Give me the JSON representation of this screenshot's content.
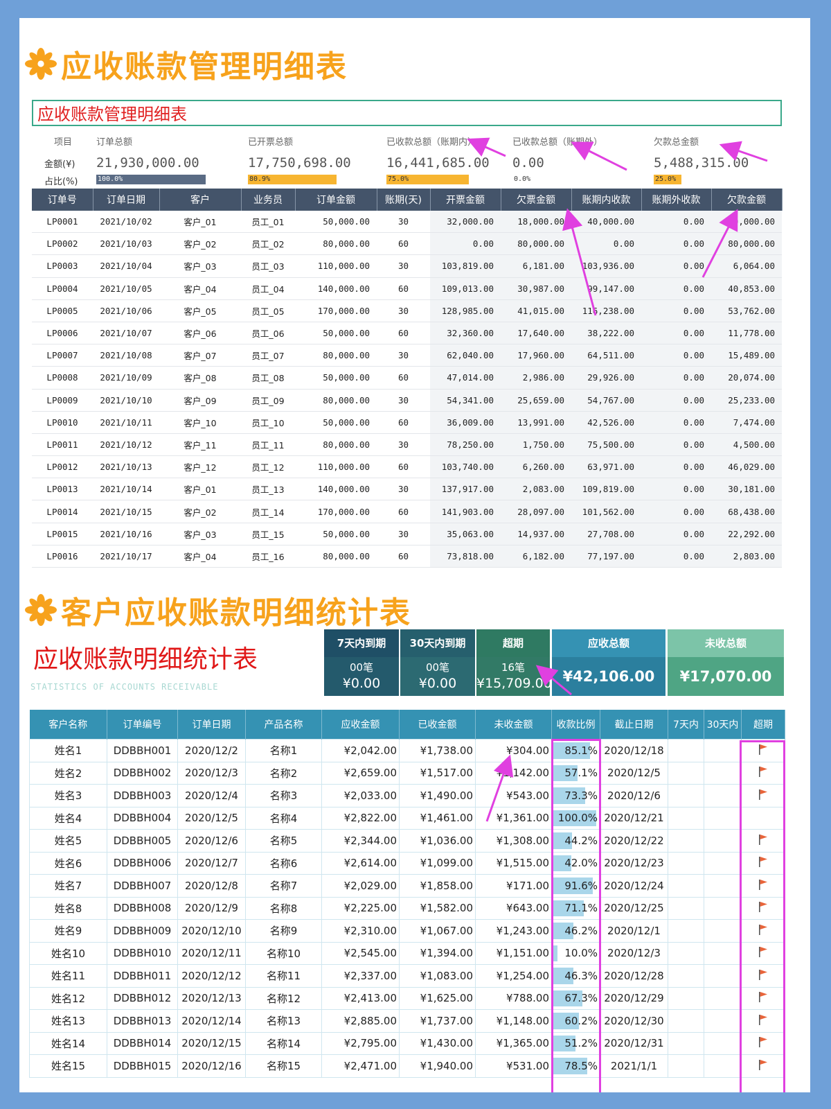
{
  "section1": {
    "heading": "应收账款管理明细表",
    "box_title": "应收账款管理明细表",
    "summary": {
      "row_labels": {
        "item": "项目",
        "amount": "金额(¥)",
        "ratio": "占比(%)"
      },
      "items": [
        {
          "label": "订单总额",
          "value": "21,930,000.00",
          "ratio": "100.0%",
          "ratio_value": 100.0,
          "bar_color": "#5a6b84"
        },
        {
          "label": "已开票总额",
          "value": "17,750,698.00",
          "ratio": "80.9%",
          "ratio_value": 80.9,
          "bar_color": "#f7b531"
        },
        {
          "label": "已收款总额（账期内）",
          "value": "16,441,685.00",
          "ratio": "75.0%",
          "ratio_value": 75.0,
          "bar_color": "#f7b531"
        },
        {
          "label": "已收款总额（账期外）",
          "value": "0.00",
          "ratio": "0.0%",
          "ratio_value": 0.0,
          "bar_color": "#f7b531"
        },
        {
          "label": "欠款总金额",
          "value": "5,488,315.00",
          "ratio": "25.0%",
          "ratio_value": 25.0,
          "bar_color": "#f7b531"
        }
      ]
    },
    "columns": [
      "订单号",
      "订单日期",
      "客户",
      "业务员",
      "订单金额",
      "账期(天)",
      "开票金额",
      "欠票金额",
      "账期内收款",
      "账期外收款",
      "欠款金额"
    ],
    "rows": [
      [
        "LP0001",
        "2021/10/02",
        "客户_01",
        "员工_01",
        "50,000.00",
        "30",
        "32,000.00",
        "18,000.00",
        "40,000.00",
        "0.00",
        "10,000.00"
      ],
      [
        "LP0002",
        "2021/10/03",
        "客户_02",
        "员工_02",
        "80,000.00",
        "60",
        "0.00",
        "80,000.00",
        "0.00",
        "0.00",
        "80,000.00"
      ],
      [
        "LP0003",
        "2021/10/04",
        "客户_03",
        "员工_03",
        "110,000.00",
        "30",
        "103,819.00",
        "6,181.00",
        "103,936.00",
        "0.00",
        "6,064.00"
      ],
      [
        "LP0004",
        "2021/10/05",
        "客户_04",
        "员工_04",
        "140,000.00",
        "60",
        "109,013.00",
        "30,987.00",
        "99,147.00",
        "0.00",
        "40,853.00"
      ],
      [
        "LP0005",
        "2021/10/06",
        "客户_05",
        "员工_05",
        "170,000.00",
        "30",
        "128,985.00",
        "41,015.00",
        "116,238.00",
        "0.00",
        "53,762.00"
      ],
      [
        "LP0006",
        "2021/10/07",
        "客户_06",
        "员工_06",
        "50,000.00",
        "60",
        "32,360.00",
        "17,640.00",
        "38,222.00",
        "0.00",
        "11,778.00"
      ],
      [
        "LP0007",
        "2021/10/08",
        "客户_07",
        "员工_07",
        "80,000.00",
        "30",
        "62,040.00",
        "17,960.00",
        "64,511.00",
        "0.00",
        "15,489.00"
      ],
      [
        "LP0008",
        "2021/10/09",
        "客户_08",
        "员工_08",
        "50,000.00",
        "60",
        "47,014.00",
        "2,986.00",
        "29,926.00",
        "0.00",
        "20,074.00"
      ],
      [
        "LP0009",
        "2021/10/10",
        "客户_09",
        "员工_09",
        "80,000.00",
        "30",
        "54,341.00",
        "25,659.00",
        "54,767.00",
        "0.00",
        "25,233.00"
      ],
      [
        "LP0010",
        "2021/10/11",
        "客户_10",
        "员工_10",
        "50,000.00",
        "60",
        "36,009.00",
        "13,991.00",
        "42,526.00",
        "0.00",
        "7,474.00"
      ],
      [
        "LP0011",
        "2021/10/12",
        "客户_11",
        "员工_11",
        "80,000.00",
        "30",
        "78,250.00",
        "1,750.00",
        "75,500.00",
        "0.00",
        "4,500.00"
      ],
      [
        "LP0012",
        "2021/10/13",
        "客户_12",
        "员工_12",
        "110,000.00",
        "60",
        "103,740.00",
        "6,260.00",
        "63,971.00",
        "0.00",
        "46,029.00"
      ],
      [
        "LP0013",
        "2021/10/14",
        "客户_01",
        "员工_13",
        "140,000.00",
        "30",
        "137,917.00",
        "2,083.00",
        "109,819.00",
        "0.00",
        "30,181.00"
      ],
      [
        "LP0014",
        "2021/10/15",
        "客户_02",
        "员工_14",
        "170,000.00",
        "60",
        "141,903.00",
        "28,097.00",
        "101,562.00",
        "0.00",
        "68,438.00"
      ],
      [
        "LP0015",
        "2021/10/16",
        "客户_03",
        "员工_15",
        "50,000.00",
        "30",
        "35,063.00",
        "14,937.00",
        "27,708.00",
        "0.00",
        "22,292.00"
      ],
      [
        "LP0016",
        "2021/10/17",
        "客户_04",
        "员工_16",
        "80,000.00",
        "60",
        "73,818.00",
        "6,182.00",
        "77,197.00",
        "0.00",
        "2,803.00"
      ]
    ]
  },
  "section2": {
    "heading": "客户应收账款明细统计表",
    "big_title": "应收账款明细统计表",
    "subtitle": "STATISTICS OF ACCOUNTS RECEIVABLE",
    "kpis": [
      {
        "label": "7天内到期",
        "count": "00笔",
        "amount": "¥0.00"
      },
      {
        "label": "30天内到期",
        "count": "00笔",
        "amount": "¥0.00"
      },
      {
        "label": "超期",
        "count": "16笔",
        "amount": "¥15,709.00"
      },
      {
        "label": "应收总额",
        "amount": "¥42,106.00"
      },
      {
        "label": "未收总额",
        "amount": "¥17,070.00"
      }
    ],
    "columns": [
      "客户名称",
      "订单编号",
      "订单日期",
      "产品名称",
      "应收金额",
      "已收金额",
      "未收金额",
      "收款比例",
      "截止日期",
      "7天内",
      "30天内",
      "超期"
    ],
    "rows": [
      {
        "name": "姓名1",
        "order": "DDBBH001",
        "date": "2020/12/2",
        "product": "名称1",
        "due": "¥2,042.00",
        "paid": "¥1,738.00",
        "unpaid": "¥304.00",
        "ratio": "85.1%",
        "ratio_value": 85.1,
        "deadline": "2020/12/18",
        "overdue": true
      },
      {
        "name": "姓名2",
        "order": "DDBBH002",
        "date": "2020/12/3",
        "product": "名称2",
        "due": "¥2,659.00",
        "paid": "¥1,517.00",
        "unpaid": "¥1,142.00",
        "ratio": "57.1%",
        "ratio_value": 57.1,
        "deadline": "2020/12/5",
        "overdue": true
      },
      {
        "name": "姓名3",
        "order": "DDBBH003",
        "date": "2020/12/4",
        "product": "名称3",
        "due": "¥2,033.00",
        "paid": "¥1,490.00",
        "unpaid": "¥543.00",
        "ratio": "73.3%",
        "ratio_value": 73.3,
        "deadline": "2020/12/6",
        "overdue": true
      },
      {
        "name": "姓名4",
        "order": "DDBBH004",
        "date": "2020/12/5",
        "product": "名称4",
        "due": "¥2,822.00",
        "paid": "¥1,461.00",
        "unpaid": "¥1,361.00",
        "ratio": "100.0%",
        "ratio_value": 100.0,
        "deadline": "2020/12/21",
        "overdue": false
      },
      {
        "name": "姓名5",
        "order": "DDBBH005",
        "date": "2020/12/6",
        "product": "名称5",
        "due": "¥2,344.00",
        "paid": "¥1,036.00",
        "unpaid": "¥1,308.00",
        "ratio": "44.2%",
        "ratio_value": 44.2,
        "deadline": "2020/12/22",
        "overdue": true
      },
      {
        "name": "姓名6",
        "order": "DDBBH006",
        "date": "2020/12/7",
        "product": "名称6",
        "due": "¥2,614.00",
        "paid": "¥1,099.00",
        "unpaid": "¥1,515.00",
        "ratio": "42.0%",
        "ratio_value": 42.0,
        "deadline": "2020/12/23",
        "overdue": true
      },
      {
        "name": "姓名7",
        "order": "DDBBH007",
        "date": "2020/12/8",
        "product": "名称7",
        "due": "¥2,029.00",
        "paid": "¥1,858.00",
        "unpaid": "¥171.00",
        "ratio": "91.6%",
        "ratio_value": 91.6,
        "deadline": "2020/12/24",
        "overdue": true
      },
      {
        "name": "姓名8",
        "order": "DDBBH008",
        "date": "2020/12/9",
        "product": "名称8",
        "due": "¥2,225.00",
        "paid": "¥1,582.00",
        "unpaid": "¥643.00",
        "ratio": "71.1%",
        "ratio_value": 71.1,
        "deadline": "2020/12/25",
        "overdue": true
      },
      {
        "name": "姓名9",
        "order": "DDBBH009",
        "date": "2020/12/10",
        "product": "名称9",
        "due": "¥2,310.00",
        "paid": "¥1,067.00",
        "unpaid": "¥1,243.00",
        "ratio": "46.2%",
        "ratio_value": 46.2,
        "deadline": "2020/12/1",
        "overdue": true
      },
      {
        "name": "姓名10",
        "order": "DDBBH010",
        "date": "2020/12/11",
        "product": "名称10",
        "due": "¥2,545.00",
        "paid": "¥1,394.00",
        "unpaid": "¥1,151.00",
        "ratio": "10.0%",
        "ratio_value": 10.0,
        "deadline": "2020/12/3",
        "overdue": true
      },
      {
        "name": "姓名11",
        "order": "DDBBH011",
        "date": "2020/12/12",
        "product": "名称11",
        "due": "¥2,337.00",
        "paid": "¥1,083.00",
        "unpaid": "¥1,254.00",
        "ratio": "46.3%",
        "ratio_value": 46.3,
        "deadline": "2020/12/28",
        "overdue": true
      },
      {
        "name": "姓名12",
        "order": "DDBBH012",
        "date": "2020/12/13",
        "product": "名称12",
        "due": "¥2,413.00",
        "paid": "¥1,625.00",
        "unpaid": "¥788.00",
        "ratio": "67.3%",
        "ratio_value": 67.3,
        "deadline": "2020/12/29",
        "overdue": true
      },
      {
        "name": "姓名13",
        "order": "DDBBH013",
        "date": "2020/12/14",
        "product": "名称13",
        "due": "¥2,885.00",
        "paid": "¥1,737.00",
        "unpaid": "¥1,148.00",
        "ratio": "60.2%",
        "ratio_value": 60.2,
        "deadline": "2020/12/30",
        "overdue": true
      },
      {
        "name": "姓名14",
        "order": "DDBBH014",
        "date": "2020/12/15",
        "product": "名称14",
        "due": "¥2,795.00",
        "paid": "¥1,430.00",
        "unpaid": "¥1,365.00",
        "ratio": "51.2%",
        "ratio_value": 51.2,
        "deadline": "2020/12/31",
        "overdue": true
      },
      {
        "name": "姓名15",
        "order": "DDBBH015",
        "date": "2020/12/16",
        "product": "名称15",
        "due": "¥2,471.00",
        "paid": "¥1,940.00",
        "unpaid": "¥531.00",
        "ratio": "78.5%",
        "ratio_value": 78.5,
        "deadline": "2021/1/1",
        "overdue": true
      }
    ]
  },
  "colors": {
    "title_orange": "#f7a21c",
    "header_slate": "#44546a",
    "header_teal": "#3592b3",
    "annotation_magenta": "#e040e0",
    "kpi_dark1": "#1f5068",
    "kpi_dark2": "#28606a",
    "kpi_dark3": "#2d6e5a",
    "kpi_blue": "#3592b3",
    "kpi_green": "#62b79a"
  },
  "icons": {
    "title_decoration": "flower-icon",
    "overdue_marker": "flag-icon"
  }
}
